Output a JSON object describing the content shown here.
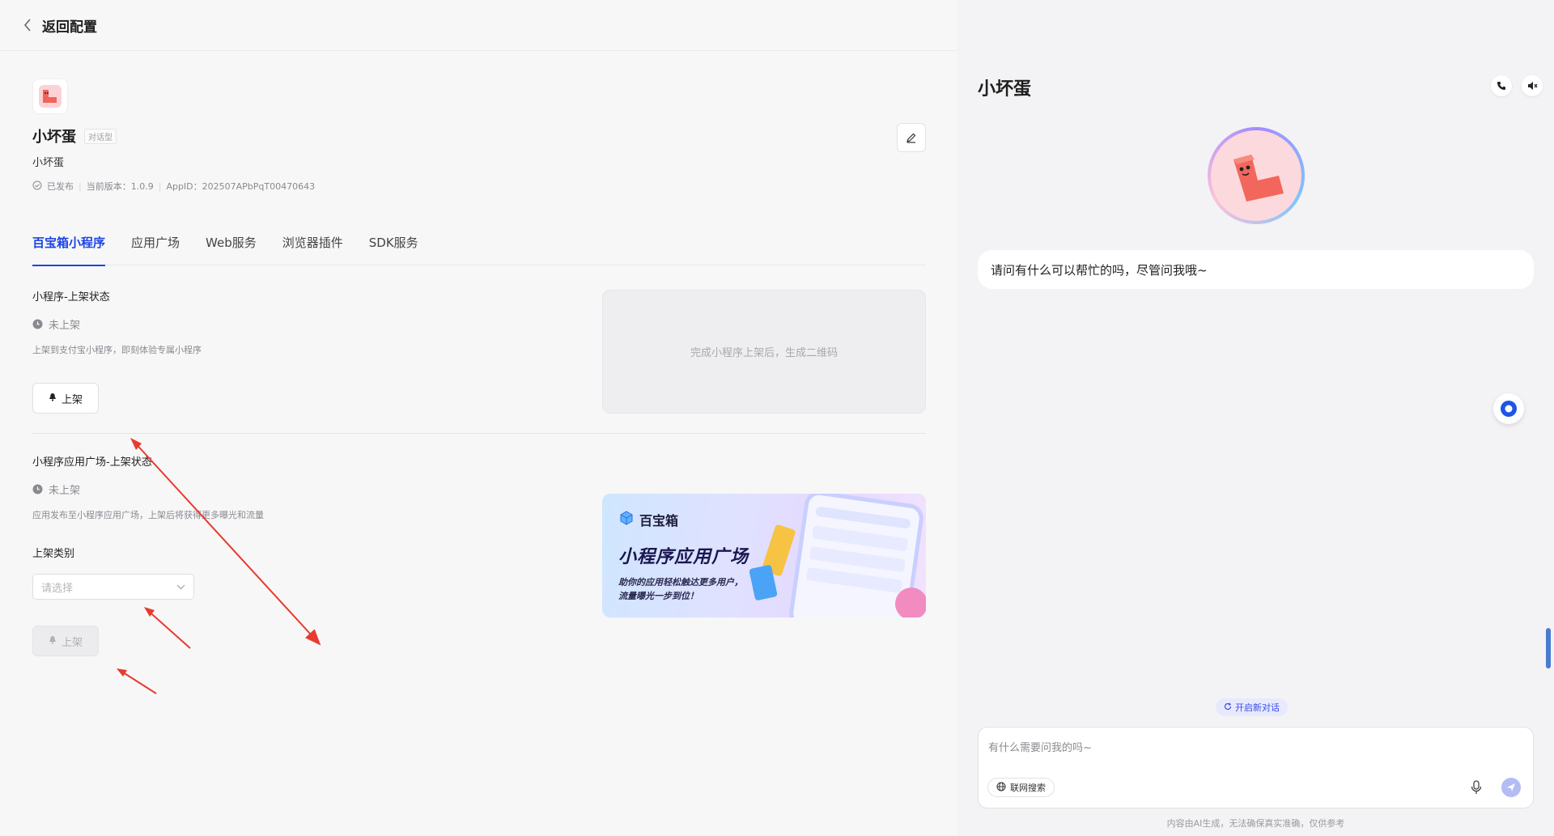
{
  "header": {
    "back_label": "返回配置"
  },
  "app": {
    "name": "小坏蛋",
    "type_badge": "对话型",
    "description": "小坏蛋",
    "status": "已发布",
    "version": "当前版本：1.0.9",
    "app_id": "AppID：202507APbPqT00470643"
  },
  "tabs": [
    "百宝箱小程序",
    "应用广场",
    "Web服务",
    "浏览器插件",
    "SDK服务"
  ],
  "mini_program": {
    "title": "小程序-上架状态",
    "status": "未上架",
    "hint": "上架到支付宝小程序，即刻体验专属小程序",
    "button": "上架",
    "qr_placeholder": "完成小程序上架后，生成二维码"
  },
  "app_square": {
    "title": "小程序应用广场-上架状态",
    "status": "未上架",
    "hint": "应用发布至小程序应用广场，上架后将获得更多曝光和流量",
    "category_label": "上架类别",
    "category_placeholder": "请选择",
    "button": "上架"
  },
  "banner": {
    "brand": "百宝箱",
    "title": "小程序应用广场",
    "sub1": "助你的应用轻松触达更多用户，",
    "sub2": "流量曝光一步到位！"
  },
  "chat": {
    "title": "小坏蛋",
    "greeting": "请问有什么可以帮忙的吗，尽管问我哦~",
    "new_chat": "开启新对话",
    "input_placeholder": "有什么需要问我的吗~",
    "web_search": "联网搜索",
    "disclaimer": "内容由AI生成，无法确保真实准确，仅供参考"
  },
  "colors": {
    "accent": "#1c44e6",
    "annotation_arrow": "#e83a2f"
  }
}
